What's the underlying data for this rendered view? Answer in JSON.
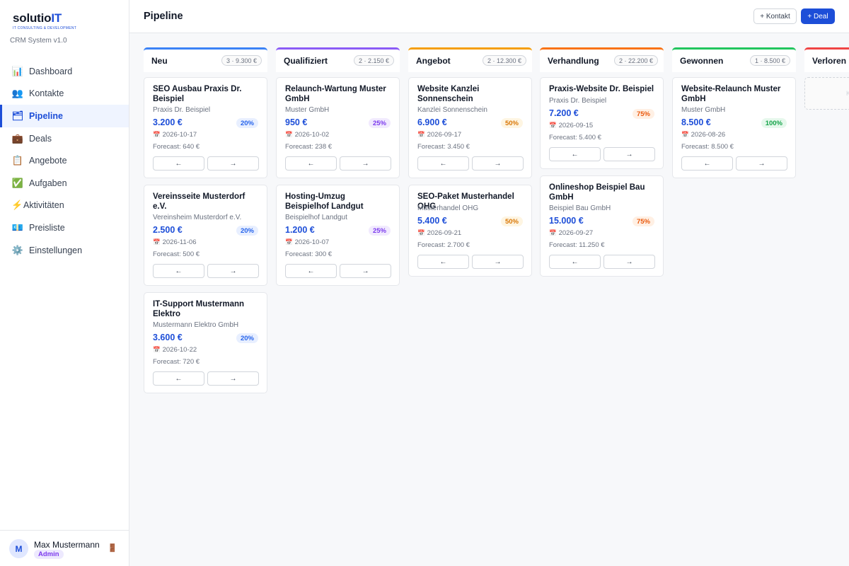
{
  "app": {
    "logo_main": "solutio",
    "logo_it": "IT",
    "logo_sub": "IT CONSULTING & DEVELOPMENT",
    "version": "CRM System v1.0"
  },
  "sidebar": {
    "items": [
      {
        "label": "Dashboard",
        "icon": "📊",
        "icon_name": "bar-chart-icon"
      },
      {
        "label": "Kontakte",
        "icon": "👥",
        "icon_name": "users-icon"
      },
      {
        "label": "Pipeline",
        "icon": "🗂",
        "icon_name": "folder-icon"
      },
      {
        "label": "Deals",
        "icon": "💼",
        "icon_name": "briefcase-icon"
      },
      {
        "label": "Angebote",
        "icon": "📋",
        "icon_name": "clipboard-icon"
      },
      {
        "label": "Aufgaben",
        "icon": "✅",
        "icon_name": "checkmark-icon"
      },
      {
        "label": "Aktivitäten",
        "icon": "⚡",
        "icon_name": "lightning-icon"
      },
      {
        "label": "Preisliste",
        "icon": "💶",
        "icon_name": "banknote-icon"
      },
      {
        "label": "Einstellungen",
        "icon": "⚙️",
        "icon_name": "gear-icon"
      }
    ],
    "active": "Pipeline"
  },
  "user": {
    "initial": "M",
    "name": "Max Mustermann",
    "role": "Admin",
    "logout_icon": "🚪"
  },
  "header": {
    "title": "Pipeline",
    "add_contact_label": "+ Kontakt",
    "add_deal_label": "+ Deal"
  },
  "colors": {
    "accent": "#1d4ed8",
    "stage_neu": "#3b82f6",
    "stage_qualifiziert": "#8b5cf6",
    "stage_angebot": "#f59e0b",
    "stage_verhandlung": "#f97316",
    "stage_gewonnen": "#22c55e",
    "stage_verloren": "#ef4444"
  },
  "card_buttons": {
    "prev": "←",
    "next": "→"
  },
  "card_labels": {
    "calendar_icon": "📅",
    "forecast_prefix": "Forecast: "
  },
  "columns": [
    {
      "title": "Neu",
      "badge": "3 · 9.300 €",
      "cards": [
        {
          "title": "SEO Ausbau Praxis Dr. Beispiel",
          "company": "Praxis Dr. Beispiel",
          "value": "3.200 €",
          "pct": "20%",
          "date": "2026-10-17",
          "forecast": "640 €"
        },
        {
          "title": "Vereinsseite Musterdorf e.V.",
          "company": "Vereinsheim Musterdorf e.V.",
          "value": "2.500 €",
          "pct": "20%",
          "date": "2026-11-06",
          "forecast": "500 €"
        },
        {
          "title": "IT-Support Mustermann Elektro",
          "company": "Mustermann Elektro GmbH",
          "value": "3.600 €",
          "pct": "20%",
          "date": "2026-10-22",
          "forecast": "720 €"
        }
      ]
    },
    {
      "title": "Qualifiziert",
      "badge": "2 · 2.150 €",
      "cards": [
        {
          "title": "Relaunch-Wartung Muster GmbH",
          "company": "Muster GmbH",
          "value": "950 €",
          "pct": "25%",
          "date": "2026-10-02",
          "forecast": "238 €"
        },
        {
          "title": "Hosting-Umzug Beispielhof Landgut",
          "company": "Beispielhof Landgut",
          "value": "1.200 €",
          "pct": "25%",
          "date": "2026-10-07",
          "forecast": "300 €"
        }
      ]
    },
    {
      "title": "Angebot",
      "badge": "2 · 12.300 €",
      "cards": [
        {
          "title": "Website Kanzlei Sonnenschein",
          "company": "Kanzlei Sonnenschein",
          "value": "6.900 €",
          "pct": "50%",
          "date": "2026-09-17",
          "forecast": "3.450 €"
        },
        {
          "title": "SEO-Paket Musterhandel OHG",
          "company": "Musterhandel OHG",
          "value": "5.400 €",
          "pct": "50%",
          "date": "2026-09-21",
          "forecast": "2.700 €"
        }
      ]
    },
    {
      "title": "Verhandlung",
      "badge": "2 · 22.200 €",
      "cards": [
        {
          "title": "Praxis-Website Dr. Beispiel",
          "company": "Praxis Dr. Beispiel",
          "value": "7.200 €",
          "pct": "75%",
          "date": "2026-09-15",
          "forecast": "5.400 €"
        },
        {
          "title": "Onlineshop Beispiel Bau GmbH",
          "company": "Beispiel Bau GmbH",
          "value": "15.000 €",
          "pct": "75%",
          "date": "2026-09-27",
          "forecast": "11.250 €"
        }
      ]
    },
    {
      "title": "Gewonnen",
      "badge": "1 · 8.500 €",
      "cards": [
        {
          "title": "Website-Relaunch Muster GmbH",
          "company": "Muster GmbH",
          "value": "8.500 €",
          "pct": "100%",
          "date": "2026-08-26",
          "forecast": "8.500 €"
        }
      ]
    },
    {
      "title": "Verloren",
      "badge": "",
      "cards": [],
      "placeholder": "K"
    }
  ]
}
